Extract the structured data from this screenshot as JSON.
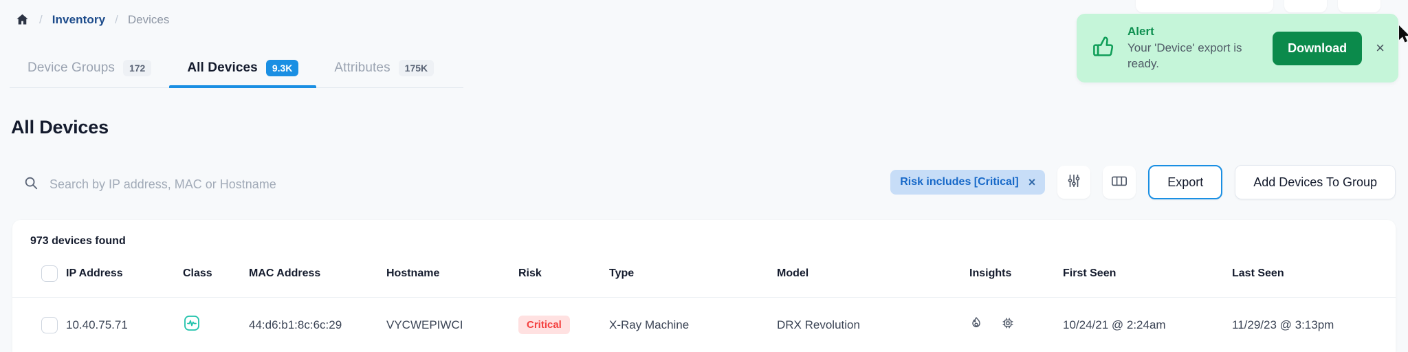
{
  "breadcrumb": {
    "home_icon": "home-icon",
    "separator": "/",
    "link": "Inventory",
    "current": "Devices"
  },
  "tabs": [
    {
      "label": "Device Groups",
      "count": "172",
      "active": false
    },
    {
      "label": "All Devices",
      "count": "9.3K",
      "active": true
    },
    {
      "label": "Attributes",
      "count": "175K",
      "active": false
    }
  ],
  "page_title": "All Devices",
  "search": {
    "icon": "search-icon",
    "placeholder": "Search by IP address, MAC or Hostname",
    "value": ""
  },
  "toolbar": {
    "filter_chip": "Risk includes [Critical]",
    "filter_chip_remove": "×",
    "filter_icon": "sliders-icon",
    "columns_icon": "columns-icon",
    "export_label": "Export",
    "add_to_group_label": "Add Devices To Group"
  },
  "table": {
    "found_text": "973 devices found",
    "columns": [
      "IP Address",
      "Class",
      "MAC Address",
      "Hostname",
      "Risk",
      "Type",
      "Model",
      "Insights",
      "First Seen",
      "Last Seen"
    ],
    "rows": [
      {
        "ip": "10.40.75.71",
        "class_icon": "medical-pulse-icon",
        "mac": "44:d6:b1:8c:6c:29",
        "hostname": "VYCWEPIWCI",
        "risk": "Critical",
        "type": "X-Ray Machine",
        "model": "DRX Revolution",
        "insights": [
          "flame-icon",
          "chip-icon"
        ],
        "first_seen": "10/24/21 @ 2:24am",
        "last_seen": "11/29/23 @ 3:13pm"
      }
    ]
  },
  "toast": {
    "icon": "thumbs-up-icon",
    "title": "Alert",
    "message": "Your 'Device' export is ready.",
    "button": "Download",
    "close": "×"
  },
  "colors": {
    "accent_blue": "#1a8fe3",
    "link_blue": "#1b4a8a",
    "critical_red": "#f4403f",
    "critical_bg": "#ffe1e1",
    "toast_bg": "#c5f5d9",
    "toast_green": "#0b8a4b",
    "class_teal": "#21c2ab",
    "page_bg": "#f7f9fb"
  }
}
